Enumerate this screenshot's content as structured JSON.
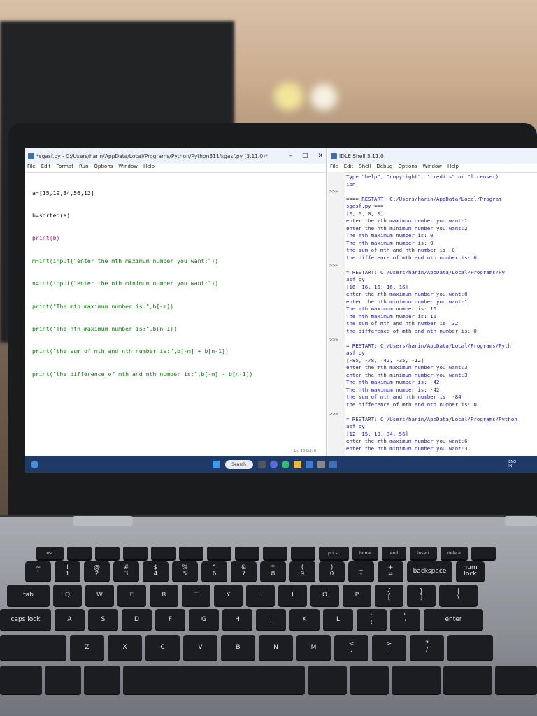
{
  "editor": {
    "title": "*sgasf.py - C:/Users/harin/AppData/Local/Programs/Python/Python311/sgasf.py (3.11.0)*",
    "menu": [
      "File",
      "Edit",
      "Format",
      "Run",
      "Options",
      "Window",
      "Help"
    ],
    "code_lines": [
      "a=[15,19,34,56,12]",
      "b=sorted(a)",
      "print(b)",
      "m=int(input(\"enter the mth maximum number you want:\"))",
      "n=int(input(\"enter the nth minimum number you want:\"))",
      "print(\"The mth maximum number is:\",b[-m])",
      "print(\"The nth maximum number is:\",b[n-1])",
      "print(\"the sum of mth and nth number is:\",b[-m] + b[n-1])",
      "print(\"the difference of mth and nth number is:\",b[-m] - b[n-1])"
    ],
    "status": "Ln: 10   Col: 0"
  },
  "shell": {
    "title": "IDLE Shell 3.11.0",
    "menu": [
      "File",
      "Edit",
      "Shell",
      "Debug",
      "Options",
      "Window",
      "Help"
    ],
    "prompt": ">>>",
    "output_text": "Type \"help\", \"copyright\", \"credits\" or \"license()\nion.\n\n==== RESTART: C:/Users/harin/AppData/Local/Program\nsgasf.py ===\n[0, 0, 0, 0]\nenter the mth maximum number you want:1\nenter the nth minimum number you want:2\nThe mth maximum number is: 0\nThe nth maximum number is: 0\nthe sum of mth and nth number is: 0\nthe difference of mth and nth number is: 0\n\n= RESTART: C:/Users/harin/AppData/Local/Programs/Py\nasf.py\n[16, 16, 16, 16, 16]\nenter the mth maximum number you want:0\nenter the nth minimum number you want:1\nThe mth maximum number is: 16\nThe nth maximum number is: 16\nthe sum of mth and nth number is: 32\nthe difference of mth and nth number is: 0\n\n= RESTART: C:/Users/harin/AppData/Local/Programs/Pyth\nasf.py\n[-85, -78, -42, -35, -12]\nenter the mth maximum number you want:3\nenter the nth minimum number you want:3\nThe mth maximum number is: -42\nThe nth maximum number is: -42\nthe sum of mth and nth number is: -84\nthe difference of mth and nth number is: 0\n\n= RESTART: C:/Users/harin/AppData/Local/Programs/Python\nasf.py\n[12, 15, 19, 34, 56]\nenter the mth maximum number you want:6\nenter the nth minimum number you want:3"
  },
  "taskbar": {
    "search": "Search",
    "lang": "ENG\nIN"
  },
  "keyboard": {
    "row_fn": [
      "esc",
      "",
      "",
      "",
      "",
      "",
      "",
      "",
      "",
      "",
      "prt sc",
      "home",
      "end",
      "insert",
      "delete",
      ""
    ],
    "row_num": [
      "~\n`",
      "!\n1",
      "@\n2",
      "#\n3",
      "$\n4",
      "%\n5",
      "^\n6",
      "&\n7",
      "*\n8",
      "(\n9",
      ")\n0",
      "_\n-",
      "+\n=",
      "backspace",
      "num\nlock"
    ],
    "row_q": [
      "tab",
      "Q",
      "W",
      "E",
      "R",
      "T",
      "Y",
      "U",
      "I",
      "O",
      "P",
      "{\n[",
      "}\n]",
      "|\n\\"
    ],
    "row_a": [
      "caps lock",
      "A",
      "S",
      "D",
      "F",
      "G",
      "H",
      "J",
      "K",
      "L",
      ":\n;",
      "\"\n'",
      "enter"
    ],
    "row_z": [
      "",
      "Z",
      "X",
      "C",
      "V",
      "B",
      "N",
      "M",
      "<\n,",
      ">\n.",
      "?\n/",
      ""
    ]
  }
}
